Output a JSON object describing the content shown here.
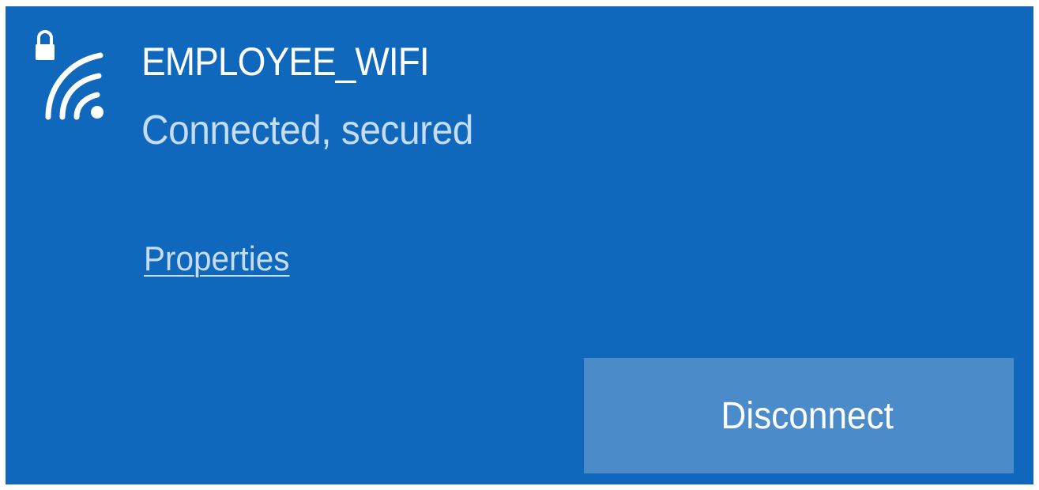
{
  "network": {
    "name": "EMPLOYEE_WIFI",
    "status": "Connected, secured",
    "icon": "wifi-secured-icon"
  },
  "links": {
    "properties_label": "Properties"
  },
  "actions": {
    "disconnect_label": "Disconnect"
  },
  "colors": {
    "panel_background": "#0f68bb",
    "button_background": "#4b8bc9",
    "primary_text": "#ffffff",
    "secondary_text": "#c6dcf2"
  }
}
